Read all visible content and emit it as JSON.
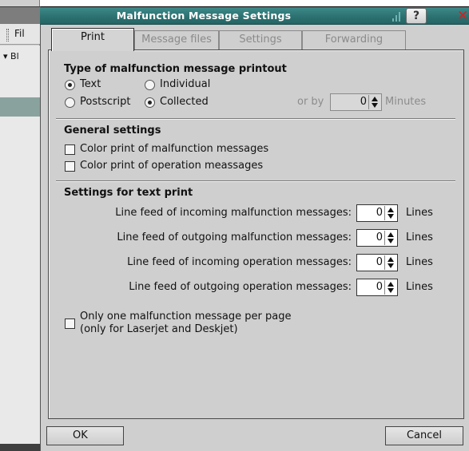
{
  "background_app": {
    "menu_text": "Fil",
    "tree_row": "▾ Bl"
  },
  "dialog": {
    "title": "Malfunction Message Settings",
    "help_symbol": "?",
    "close_symbol": "✕"
  },
  "tabs": [
    {
      "label": "Print",
      "active": true
    },
    {
      "label": "Message files",
      "active": false
    },
    {
      "label": "Settings",
      "active": false
    },
    {
      "label": "Forwarding",
      "active": false
    }
  ],
  "printout_type": {
    "title": "Type of malfunction message printout",
    "options": {
      "text": {
        "label": "Text",
        "checked": true
      },
      "individual": {
        "label": "Individual",
        "checked": false
      },
      "postscript": {
        "label": "Postscript",
        "checked": false
      },
      "collected": {
        "label": "Collected",
        "checked": true
      }
    },
    "or_by_label": "or by",
    "or_by_value": "0",
    "minutes_label": "Minutes"
  },
  "general_settings": {
    "title": "General settings",
    "color_malfunction": {
      "label": "Color print of malfunction messages",
      "checked": false
    },
    "color_operation": {
      "label": "Color print of operation meassages",
      "checked": false
    }
  },
  "text_print": {
    "title": "Settings for text print",
    "rows": [
      {
        "label": "Line feed of incoming malfunction messages:",
        "value": "0",
        "unit": "Lines"
      },
      {
        "label": "Line feed of outgoing malfunction messages:",
        "value": "0",
        "unit": "Lines"
      },
      {
        "label": "Line feed of incoming operation messages:",
        "value": "0",
        "unit": "Lines"
      },
      {
        "label": "Line feed of outgoing operation messages:",
        "value": "0",
        "unit": "Lines"
      }
    ],
    "one_per_page": {
      "line1": "Only one malfunction message per page",
      "line2": "(only for Laserjet and Deskjet)",
      "checked": false
    }
  },
  "buttons": {
    "ok": "OK",
    "cancel": "Cancel"
  },
  "colors": {
    "titlebar": "#2c7070",
    "dialog_bg": "#cfcfcf",
    "selection_bg": "#8aa29e"
  }
}
